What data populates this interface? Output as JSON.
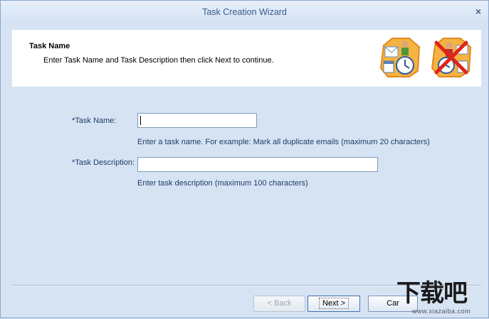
{
  "window": {
    "title": "Task Creation Wizard",
    "close_glyph": "×"
  },
  "header": {
    "title": "Task Name",
    "subtitle": "Enter Task Name and Task Description then click Next to continue.",
    "icons": [
      "task-schedule-icon",
      "task-delete-icon"
    ]
  },
  "form": {
    "task_name": {
      "label": "*Task Name:",
      "value": "",
      "hint": "Enter a task name. For example: Mark all duplicate emails (maximum 20 characters)"
    },
    "task_description": {
      "label": "*Task Description:",
      "value": "",
      "hint": "Enter task description (maximum 100 characters)"
    }
  },
  "buttons": {
    "back": "< Back",
    "next": "Next >",
    "cancel": "Car"
  },
  "watermark": {
    "main": "下载吧",
    "sub": "www.xiazaiba.com"
  },
  "colors": {
    "background": "#d6e3f3",
    "title_text": "#3b5a86",
    "label_text": "#1f3b66"
  }
}
